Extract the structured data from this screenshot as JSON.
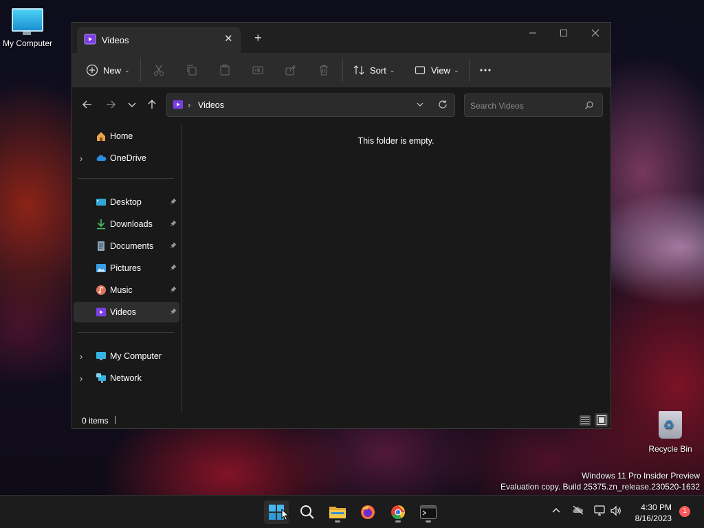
{
  "desktop": {
    "icons": [
      {
        "label": "My Computer"
      },
      {
        "label": "Recycle Bin"
      }
    ],
    "watermark": {
      "line1": "Windows 11 Pro Insider Preview",
      "line2": "Evaluation copy. Build 25375.zn_release.230520-1632"
    }
  },
  "window": {
    "tab_title": "Videos",
    "toolbar": {
      "new_label": "New",
      "sort_label": "Sort",
      "view_label": "View"
    },
    "address": {
      "segment": "Videos",
      "separator": "›",
      "search_placeholder": "Search Videos"
    },
    "sidebar": {
      "items": [
        {
          "label": "Home",
          "icon": "home-icon"
        },
        {
          "label": "OneDrive",
          "icon": "cloud-icon"
        },
        {
          "label": "Desktop",
          "icon": "desktop-icon"
        },
        {
          "label": "Downloads",
          "icon": "download-icon"
        },
        {
          "label": "Documents",
          "icon": "document-icon"
        },
        {
          "label": "Pictures",
          "icon": "picture-icon"
        },
        {
          "label": "Music",
          "icon": "music-icon"
        },
        {
          "label": "Videos",
          "icon": "video-icon"
        },
        {
          "label": "My Computer",
          "icon": "computer-icon"
        },
        {
          "label": "Network",
          "icon": "network-icon"
        }
      ]
    },
    "content": {
      "empty_message": "This folder is empty."
    },
    "status": {
      "item_count": "0 items"
    }
  },
  "taskbar": {
    "clock_time": "4:30 PM",
    "clock_date": "8/16/2023",
    "notification_count": "1"
  },
  "colors": {
    "accent": "#0078d4",
    "video_purple": "#8a3ff0",
    "window_bg": "#191919"
  }
}
